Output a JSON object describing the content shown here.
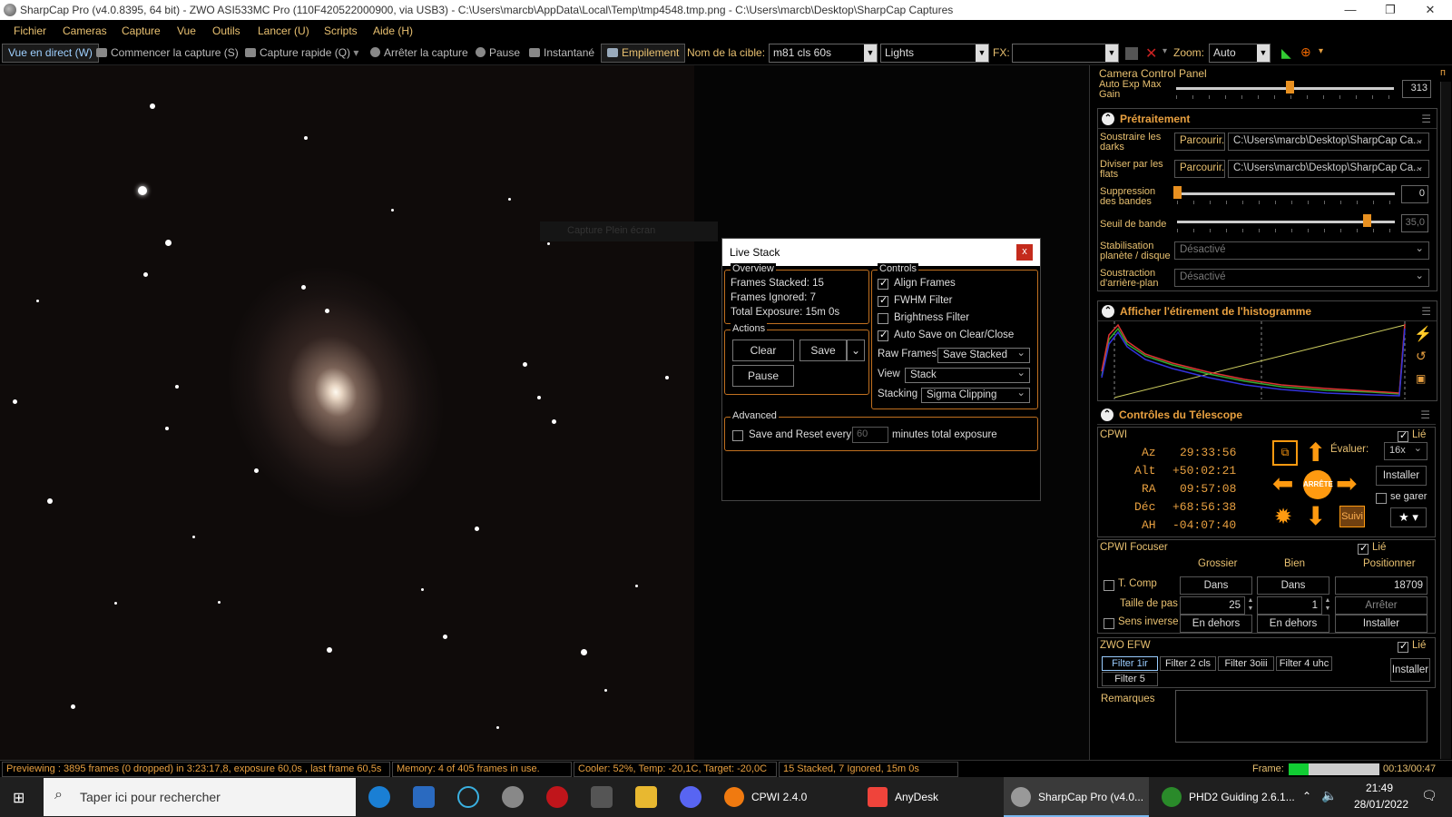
{
  "window": {
    "title": "SharpCap Pro (v4.0.8395, 64 bit) - ZWO ASI533MC Pro (110F420522000900, via USB3) - C:\\Users\\marcb\\AppData\\Local\\Temp\\tmp4548.tmp.png - C:\\Users\\marcb\\Desktop\\SharpCap Captures",
    "minimize": "—",
    "maximize": "❐",
    "close": "✕"
  },
  "menu": [
    "Fichier",
    "Cameras",
    "Capture",
    "Vue",
    "Outils",
    "Lancer (U)",
    "Scripts",
    "Aide (H)"
  ],
  "toolbar": {
    "live_view": "Vue en direct (W)",
    "start_capture": "Commencer la capture (S)",
    "quick_capture": "Capture rapide (Q)",
    "stop_capture": "Arrêter la capture",
    "pause": "Pause",
    "snapshot": "Instantané",
    "stacking": "Empilement",
    "target_label": "Nom de la cible:",
    "target_value": "m81 cls 60s",
    "frame_type": "Lights",
    "fx_label": "FX:",
    "fx_value": "",
    "zoom_label": "Zoom:",
    "zoom_value": "Auto"
  },
  "viewer": {
    "ghost_text": "Capture Plein écran"
  },
  "live_stack": {
    "title": "Live Stack",
    "close": "x",
    "overview": {
      "label": "Overview",
      "frames_stacked": "Frames Stacked:  15",
      "frames_ignored": "Frames Ignored:  7",
      "total_exposure": "Total Exposure:   15m 0s"
    },
    "actions": {
      "label": "Actions",
      "clear": "Clear",
      "save": "Save",
      "pause": "Pause"
    },
    "controls": {
      "label": "Controls",
      "align_frames": "Align Frames",
      "fwhm_filter": "FWHM Filter",
      "brightness_filter": "Brightness Filter",
      "auto_save": "Auto Save on Clear/Close",
      "raw_frames_label": "Raw Frames",
      "raw_frames_value": "Save Stacked",
      "view_label": "View",
      "view_value": "Stack",
      "stacking_label": "Stacking",
      "stacking_value": "Sigma Clipping"
    },
    "advanced": {
      "label": "Advanced",
      "save_reset": "Save and Reset every",
      "minutes_value": "60",
      "minutes_suffix": "minutes total exposure"
    }
  },
  "right_panel": {
    "header": "Camera Control Panel",
    "pin": "ᴨ",
    "auto_exp_max_gain_label": "Auto Exp Max Gain",
    "auto_exp_max_gain_value": "313",
    "auto_exp_max_gain_level": 0.52,
    "pretreatment": {
      "title": "Prétraitement",
      "darks_label": "Soustraire les darks",
      "darks_browse": "Parcourir...",
      "darks_path": "C:\\Users\\marcb\\Desktop\\SharpCap Ca...",
      "flats_label": "Diviser par les flats",
      "flats_browse": "Parcourir...",
      "flats_path": "C:\\Users\\marcb\\Desktop\\SharpCap Ca...",
      "banding_label": "Suppression des bandes",
      "banding_value": "0",
      "banding_level": 0.0,
      "band_threshold_label": "Seuil de bande",
      "band_threshold_value": "35,0",
      "band_threshold_level": 0.87,
      "stabilization_label": "Stabilisation planète / disque",
      "stabilization_value": "Désactivé",
      "background_label": "Soustraction d'arrière-plan",
      "background_value": "Désactivé"
    },
    "histogram": {
      "title": "Afficher l'étirement de l'histogramme"
    },
    "telescope": {
      "title": "Contrôles du Télescope",
      "mount_name": "CPWI",
      "linked": "Lié",
      "az_label": "Az",
      "az_value": "29:33:56",
      "alt_label": "Alt",
      "alt_value": "+50:02:21",
      "ra_label": "RA",
      "ra_value": "09:57:08",
      "dec_label": "Déc",
      "dec_value": "+68:56:38",
      "ah_label": "AH",
      "ah_value": "-04:07:40",
      "stop": "ARRÊTE",
      "rate_label": "Évaluer:",
      "rate_value": "16x",
      "setup": "Installer",
      "park": "se garer",
      "track": "Suivi"
    },
    "focuser": {
      "title": "CPWI Focuser",
      "linked": "Lié",
      "coarse": "Grossier",
      "fine": "Bien",
      "positioner": "Positionner",
      "tcomp": "T. Comp",
      "in": "Dans",
      "position": "18709",
      "step_label": "Taille de pas",
      "coarse_step": "25",
      "fine_step": "1",
      "stop": "Arrêter",
      "reverse": "Sens inverse",
      "out": "En dehors",
      "setup": "Installer"
    },
    "efw": {
      "title": "ZWO EFW",
      "linked": "Lié",
      "filters": [
        "Filter 1ir",
        "Filter 2 cls",
        "Filter 3oiii",
        "Filter 4 uhc",
        "Filter 5"
      ],
      "setup": "Installer"
    },
    "notes_label": "Remarques"
  },
  "statusbar": {
    "previewing": "Previewing : 3895 frames (0 dropped) in 3:23:17,8, exposure 60,0s , last frame 60,5s",
    "memory": "Memory: 4 of 405 frames in use.",
    "cooler": "Cooler: 52%, Temp: -20,1C, Target: -20,0C",
    "stacked": "15 Stacked, 7 Ignored, 15m 0s",
    "frame_label": "Frame:",
    "frame_time": "00:13/00:47",
    "frame_progress": 0.22
  },
  "taskbar": {
    "search": "Taper ici pour rechercher",
    "apps": [
      "CPWI 2.4.0",
      "AnyDesk",
      "SharpCap Pro (v4.0...",
      "PHD2 Guiding 2.6.1..."
    ],
    "time": "21:49",
    "date": "28/01/2022"
  }
}
